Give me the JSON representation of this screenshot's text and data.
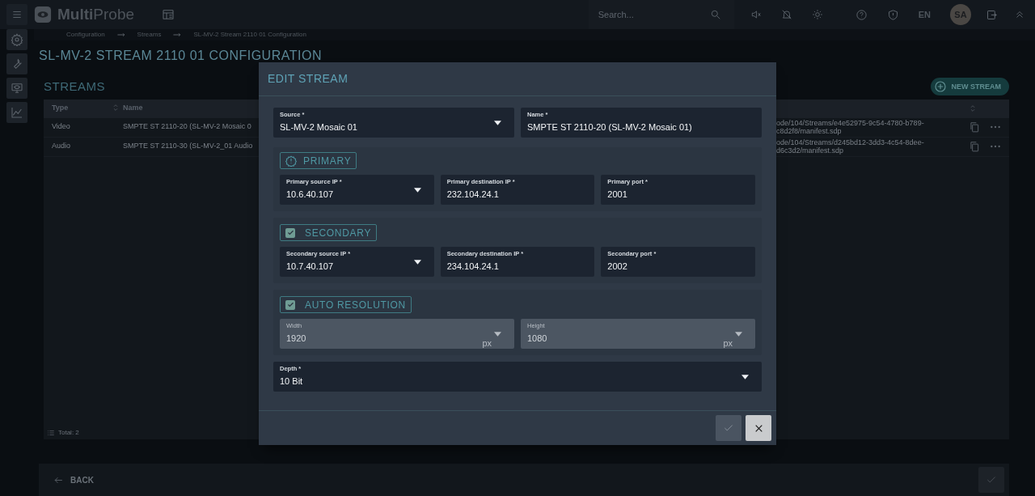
{
  "header": {
    "logo": "**Multi**Probe",
    "search": {
      "placeholder": "Search..."
    },
    "language": "EN",
    "avatar": "SA"
  },
  "breadcrumb": [
    "Configuration",
    "Streams",
    "SL-MV-2 Stream 2110 01 Configuration"
  ],
  "page_title": "SL-MV-2 STREAM 2110 01 CONFIGURATION",
  "streams": {
    "title": "STREAMS",
    "new_button": "NEW STREAM",
    "columns": [
      "Type",
      "Name"
    ],
    "rows": [
      {
        "type": "Video",
        "name": "SMPTE ST 2110-20 (SL-MV-2 Mosaic 0",
        "url": [
          "ode/104/Streams/e4e52975-9c54-4780-b789-",
          "c8d2f8/manifest.sdp"
        ]
      },
      {
        "type": "Audio",
        "name": "SMPTE ST 2110-30 (SL-MV-2_01 Audio",
        "url": [
          "ode/104/Streams/d245bd12-3dd3-4c54-8dee-",
          "d6c3d2/manifest.sdp"
        ]
      }
    ],
    "total": "Total: 2"
  },
  "footer": {
    "back_button": "BACK",
    "save_disabled": true
  },
  "dialog": {
    "title": "EDIT STREAM",
    "top_fields": [
      {
        "label": "Source *",
        "value": "SL-MV-2 Mosaic 01",
        "kind": "select",
        "disabled": false
      },
      {
        "label": "Name *",
        "value": "SMPTE ST 2110-20 (SL-MV-2 Mosaic 01)",
        "kind": "text",
        "disabled": false
      }
    ],
    "sections": [
      {
        "title": "PRIMARY",
        "kind": "info",
        "fields": [
          {
            "label": "Primary source IP *",
            "value": "10.6.40.107",
            "kind": "select",
            "disabled": false
          },
          {
            "label": "Primary destination IP *",
            "value": "232.104.24.1",
            "kind": "text",
            "disabled": false
          },
          {
            "label": "Primary port *",
            "value": "2001",
            "kind": "text",
            "disabled": false
          }
        ]
      },
      {
        "title": "SECONDARY",
        "kind": "checkbox",
        "checked": true,
        "fields": [
          {
            "label": "Secondary source IP *",
            "value": "10.7.40.107",
            "kind": "select",
            "disabled": false
          },
          {
            "label": "Secondary destination IP *",
            "value": "234.104.24.1",
            "kind": "text",
            "disabled": false
          },
          {
            "label": "Secondary port *",
            "value": "2002",
            "kind": "text",
            "disabled": false
          }
        ]
      },
      {
        "title": "AUTO RESOLUTION",
        "kind": "checkbox",
        "checked": true,
        "fields": [
          {
            "label": "Width",
            "value": "1920",
            "unit": "px",
            "kind": "select",
            "disabled": true
          },
          {
            "label": "Height",
            "value": "1080",
            "unit": "px",
            "kind": "select",
            "disabled": true
          }
        ]
      }
    ],
    "bottom_fields": [
      {
        "label": "Depth *",
        "value": "10 Bit",
        "kind": "select",
        "disabled": false
      }
    ],
    "buttons": [
      {
        "kind": "ok",
        "disabled": true
      },
      {
        "kind": "cancel",
        "disabled": false
      }
    ]
  }
}
